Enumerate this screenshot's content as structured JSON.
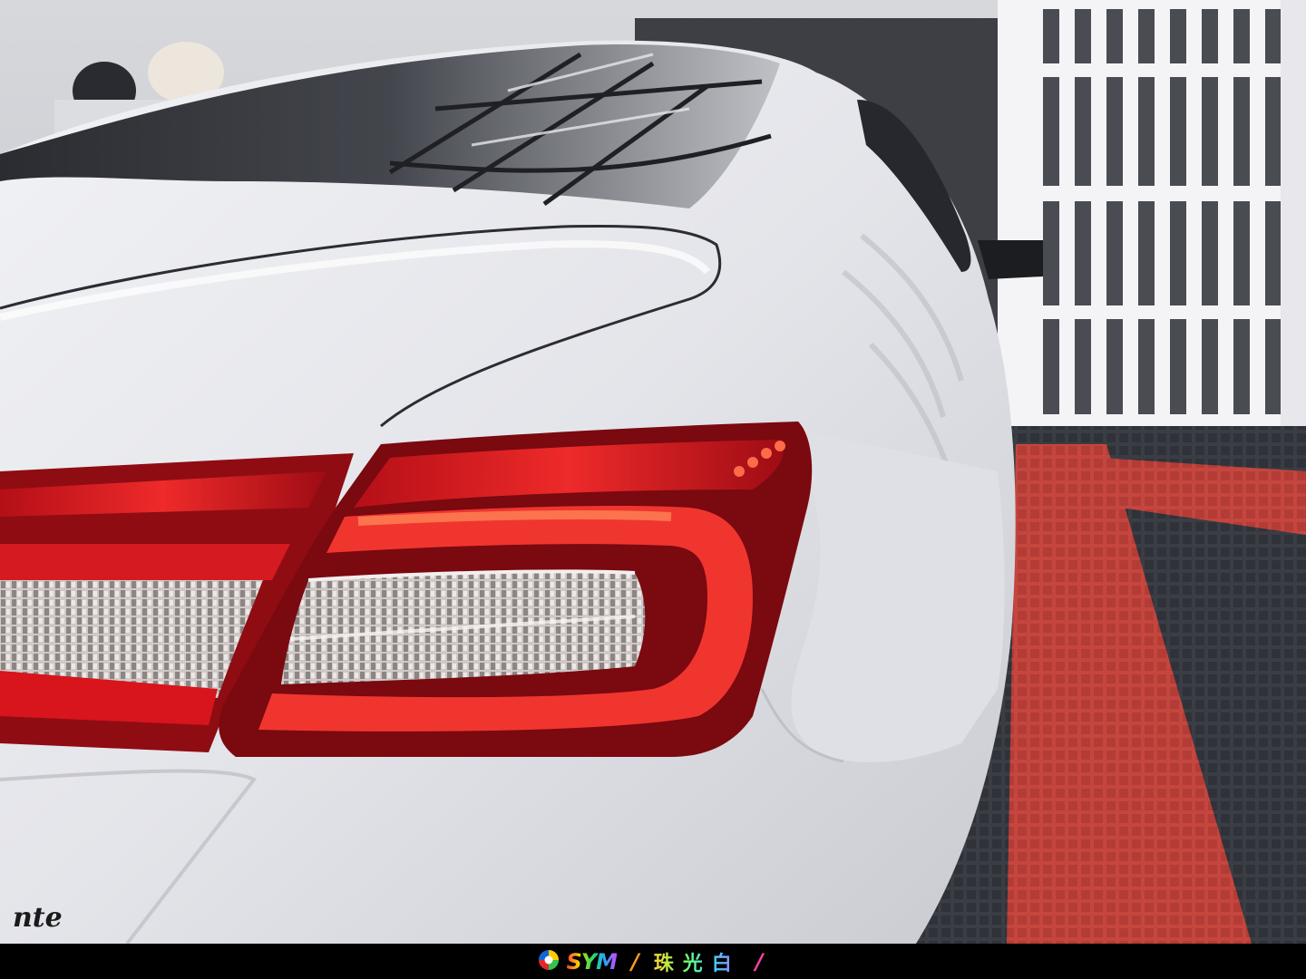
{
  "caption": {
    "brand": "SYM",
    "separator_left": "/",
    "separator_right": "/",
    "color_name": "珠光白"
  },
  "badge": {
    "text": "nte"
  },
  "colors": {
    "car_body": "#e9eaee",
    "taillight_red": "#d8141c",
    "floor_red": "#c4463e",
    "floor_dark": "#3b3d44"
  },
  "icons": {
    "logo": "sym-swirl-logo-icon"
  }
}
